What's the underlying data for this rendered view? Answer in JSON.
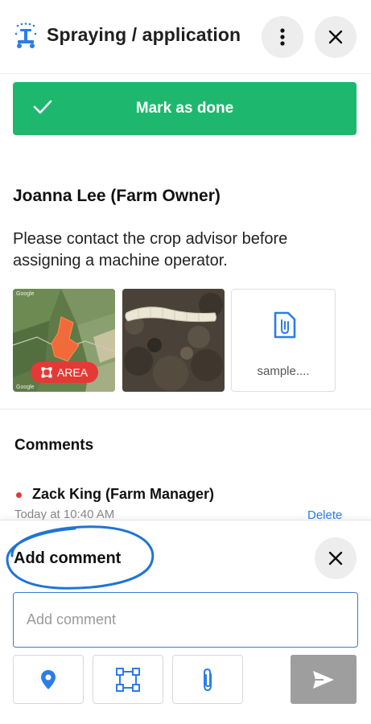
{
  "header": {
    "title": "Spraying / application",
    "app_icon": "sprayer-icon",
    "more_icon": "more-vertical-icon",
    "close_icon": "close-icon"
  },
  "task": {
    "mark_done_label": "Mark as done",
    "check_icon": "check-icon",
    "accent_color": "#1db86e"
  },
  "note": {
    "author": "Joanna Lee (Farm Owner)",
    "text": "Please contact the crop advisor before assigning a machine operator.",
    "attachments": [
      {
        "kind": "map",
        "badge_label": "AREA",
        "badge_icon": "area-icon",
        "badge_color": "#e53935"
      },
      {
        "kind": "photo"
      },
      {
        "kind": "file",
        "icon": "document-attachment-icon",
        "name": "sample...."
      }
    ]
  },
  "comments": {
    "heading": "Comments",
    "items": [
      {
        "author": "Zack King (Farm Manager)",
        "time": "Today at 10:40 AM",
        "delete_label": "Delete",
        "unread_color": "#e53935"
      }
    ]
  },
  "add_comment": {
    "title": "Add comment",
    "placeholder": "Add comment",
    "close_icon": "close-icon",
    "tools": [
      {
        "name": "location",
        "icon": "location-pin-icon"
      },
      {
        "name": "area",
        "icon": "area-select-icon"
      },
      {
        "name": "attach",
        "icon": "paperclip-icon"
      }
    ],
    "send_icon": "send-icon",
    "link_color": "#2b7de9"
  }
}
